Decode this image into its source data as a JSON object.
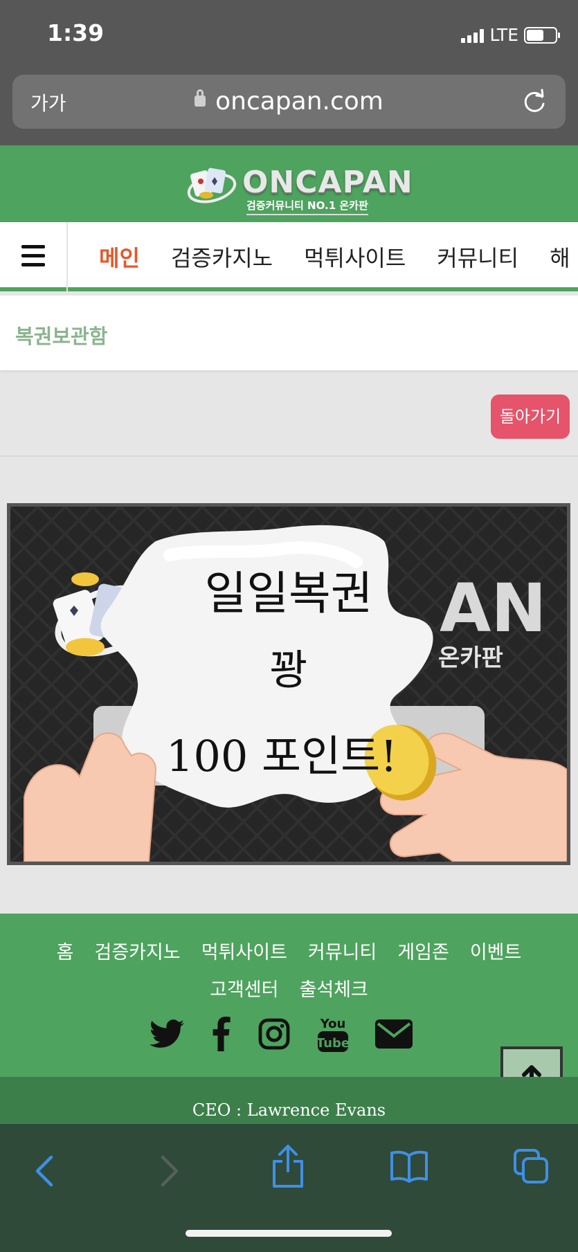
{
  "status": {
    "time": "1:39",
    "network": "LTE",
    "battery_level": 0.6
  },
  "browser": {
    "text_size_label": "가가",
    "url": "oncapan.com"
  },
  "site": {
    "logo_text": "ONCAPAN",
    "logo_sub": "검증커뮤니티 NO.1 온카판"
  },
  "nav": {
    "items": [
      "메인",
      "검증카지노",
      "먹튀사이트",
      "커뮤니티",
      "해"
    ],
    "active_index": 0
  },
  "page": {
    "title": "복권보관함",
    "back_label": "돌아가기"
  },
  "banner": {
    "line1": "일일복권",
    "line2": "꽝",
    "line3": "100 포인트!"
  },
  "footer": {
    "links": [
      "홈",
      "검증카지노",
      "먹튀사이트",
      "커뮤니티",
      "게임존",
      "이벤트",
      "고객센터",
      "출석체크"
    ],
    "social": [
      "twitter-icon",
      "facebook-icon",
      "instagram-icon",
      "youtube-icon",
      "mail-icon"
    ],
    "copyright": "CEO : Lawrence Evans"
  },
  "colors": {
    "green": "#4ea35e",
    "nav_active": "#e8572a",
    "back_button": "#e5546a",
    "toolbar_blue": "#3f8fe6"
  }
}
